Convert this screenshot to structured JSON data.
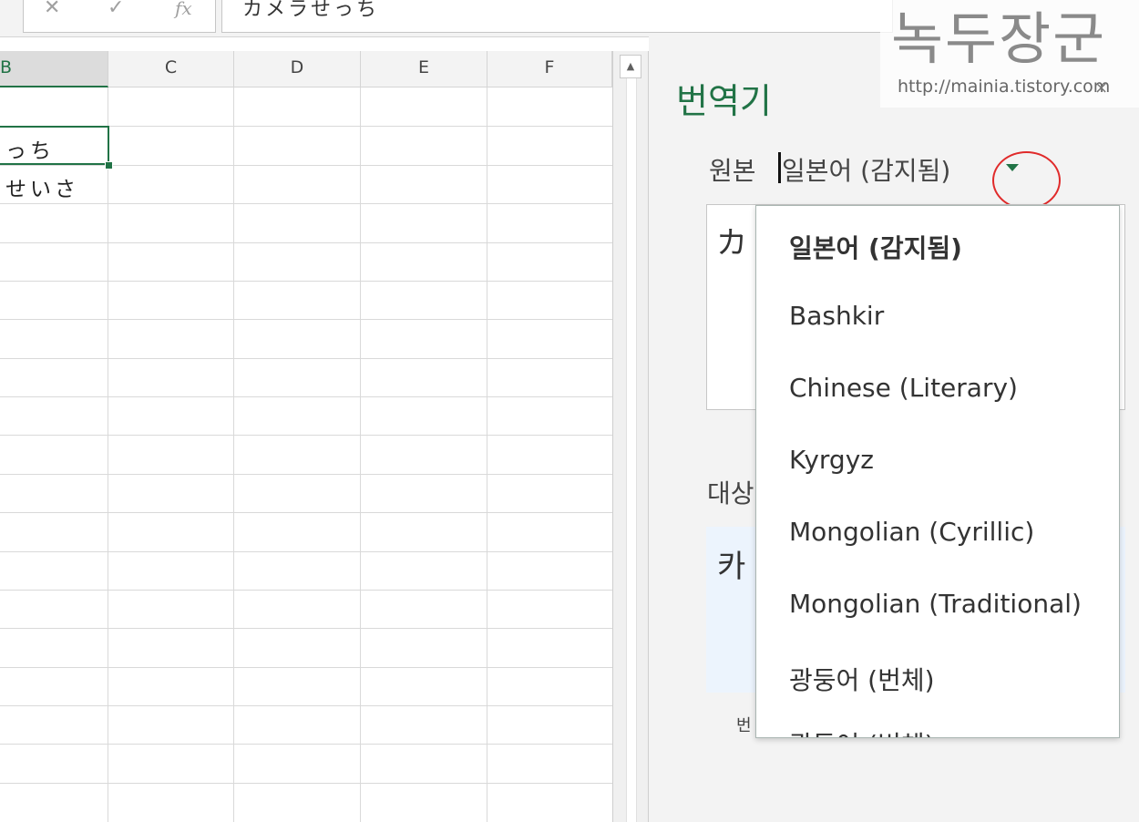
{
  "formula_bar": {
    "cancel_icon": "✕",
    "enter_icon": "✓",
    "fx_label": "fx",
    "content": "カメラせっち"
  },
  "columns": [
    "B",
    "C",
    "D",
    "E",
    "F"
  ],
  "cells": {
    "b1": "っち",
    "b2": "せいさ"
  },
  "scrollbar": {
    "up_arrow": "▲"
  },
  "translator": {
    "title": "번역기",
    "source_label": "원본",
    "source_language": "일본어 (감지됨)",
    "source_preview": "カ",
    "target_label": "대상",
    "target_preview": "카",
    "footer_text": "번"
  },
  "dropdown": {
    "items": [
      "일본어 (감지됨)",
      "Bashkir",
      "Chinese (Literary)",
      "Kyrgyz",
      "Mongolian (Cyrillic)",
      "Mongolian (Traditional)",
      "광둥어 (번체)",
      "광둥어 (번체)"
    ]
  },
  "watermark": {
    "title": "녹두장군",
    "url": "http://mainia.tistory.com",
    "close": "×"
  },
  "colors": {
    "accent_green": "#217346",
    "annotation_red": "#e02a2a"
  }
}
